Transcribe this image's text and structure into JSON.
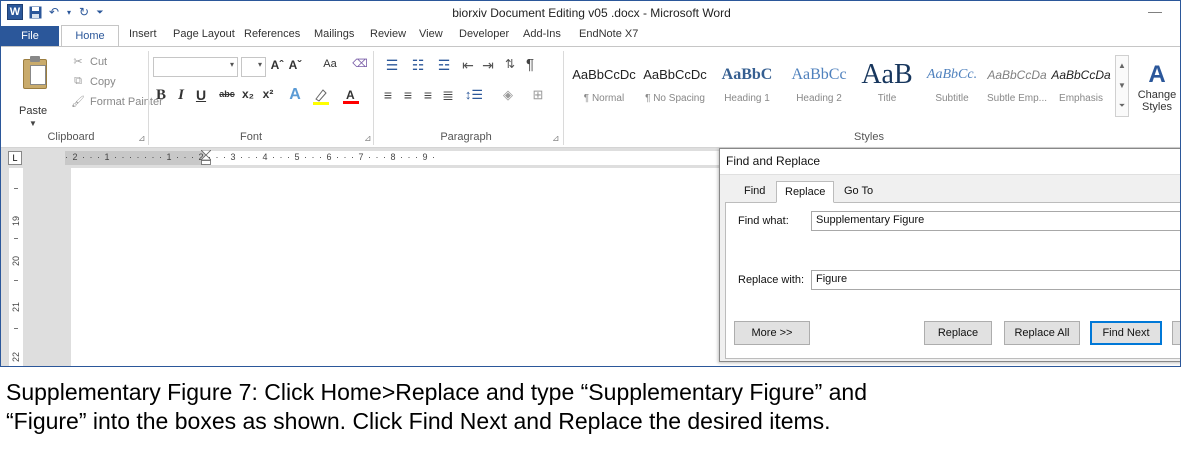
{
  "window": {
    "title": "biorxiv Document Editing v05 .docx - Microsoft Word",
    "app_icon": "W",
    "minimize": "—"
  },
  "tabs": [
    "File",
    "Home",
    "Insert",
    "Page Layout",
    "References",
    "Mailings",
    "Review",
    "View",
    "Developer",
    "Add-Ins",
    "EndNote X7"
  ],
  "ribbon": {
    "clipboard": {
      "paste": "Paste",
      "cut": "Cut",
      "copy": "Copy",
      "format_painter": "Format Painter",
      "group": "Clipboard"
    },
    "font": {
      "group": "Font",
      "grow": "Aˆ",
      "shrink": "Aˇ",
      "case": "Aa",
      "bold": "B",
      "italic": "I",
      "underline": "U",
      "strike": "abc",
      "subscript": "x₂",
      "superscript": "x²"
    },
    "paragraph": {
      "group": "Paragraph",
      "pilcrow": "¶"
    },
    "styles": {
      "group": "Styles",
      "items": [
        {
          "preview": "AaBbCcDc",
          "name": "¶ Normal"
        },
        {
          "preview": "AaBbCcDc",
          "name": "¶ No Spacing"
        },
        {
          "preview": "AaBbC",
          "name": "Heading 1"
        },
        {
          "preview": "AaBbCc",
          "name": "Heading 2"
        },
        {
          "preview": "AaB",
          "name": "Title"
        },
        {
          "preview": "AaBbCc.",
          "name": "Subtitle"
        },
        {
          "preview": "AaBbCcDa",
          "name": "Subtle Emp..."
        },
        {
          "preview": "AaBbCcDa",
          "name": "Emphasis"
        }
      ],
      "change_styles": "Change Styles"
    }
  },
  "ruler": {
    "marks": "· 2 · · · 1 · · · · · · · 1 · · · 2 · · · 3 · · · 4 · · · 5 · · · 6 · · · 7 · · · 8 · · · 9 ·",
    "vertical": [
      "19",
      "20",
      "21",
      "22"
    ]
  },
  "dialog": {
    "title": "Find and Replace",
    "tabs": {
      "find": "Find",
      "replace": "Replace",
      "goto": "Go To"
    },
    "find_label": "Find what:",
    "find_value": "Supplementary Figure",
    "replace_label": "Replace with:",
    "replace_value": "Figure",
    "buttons": {
      "more": "More >>",
      "replace": "Replace",
      "replace_all": "Replace All",
      "find_next": "Find Next"
    }
  },
  "caption": {
    "line1": "Supplementary Figure 7: Click Home>Replace and type “Supplementary Figure” and",
    "line2": "“Figure” into the boxes as shown. Click Find Next and Replace the desired items."
  }
}
